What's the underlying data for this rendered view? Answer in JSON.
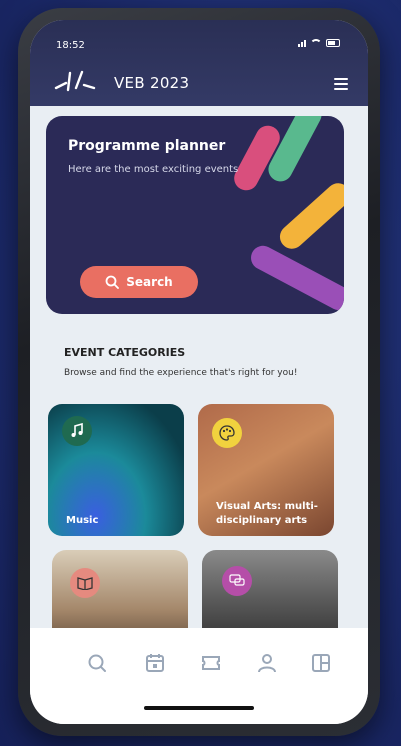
{
  "status": {
    "time": "18:52"
  },
  "header": {
    "title": "VEB 2023"
  },
  "hero": {
    "title": "Programme planner",
    "subtitle": "Here are the most exciting events",
    "search_label": "Search"
  },
  "categories": {
    "title": "EVENT CATEGORIES",
    "subtitle": "Browse and find the experience that's right for you!",
    "items": [
      {
        "label": "Music",
        "icon": "music-icon"
      },
      {
        "label": "Visual Arts: multi-disciplinary arts",
        "icon": "palette-icon"
      },
      {
        "label": "",
        "icon": "book-icon"
      },
      {
        "label": "",
        "icon": "chat-icon"
      }
    ]
  },
  "tabbar": {
    "items": [
      "search-icon",
      "calendar-icon",
      "ticket-icon",
      "profile-icon",
      "map-icon"
    ]
  },
  "colors": {
    "accent": "#e96f62",
    "header": "#2a2f55",
    "hero": "#2b2a57"
  }
}
